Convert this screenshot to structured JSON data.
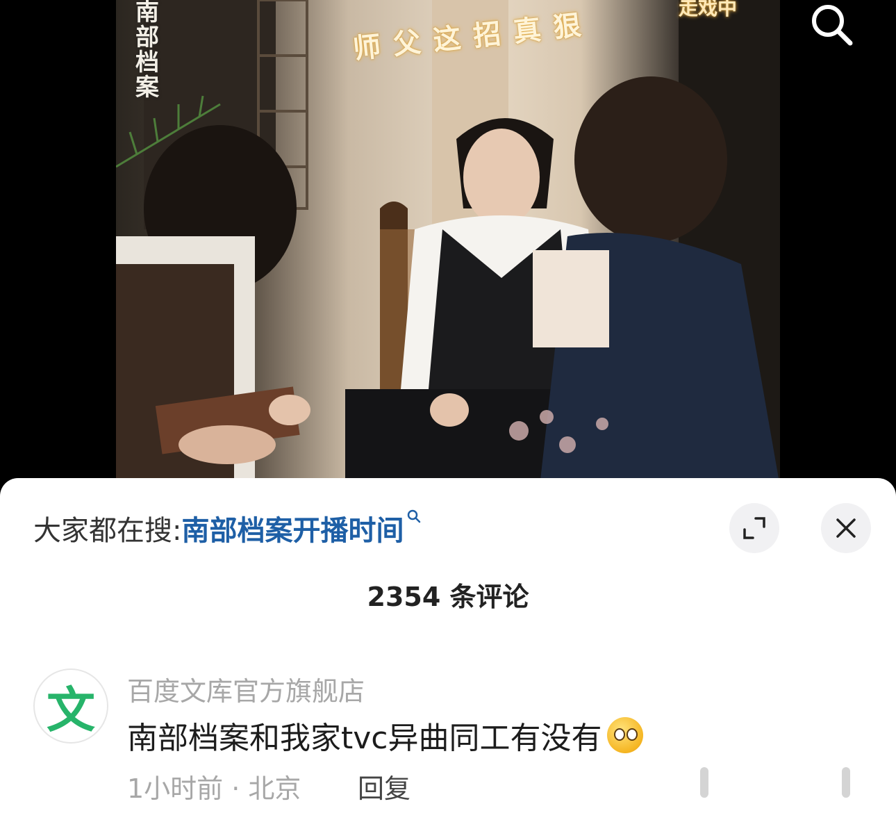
{
  "video": {
    "drama_logo": "南部档案",
    "caption": "师父这招真狠",
    "status_tag": "走戏中"
  },
  "search_icon": "search-icon",
  "trending": {
    "label": "大家都在搜:",
    "query": "南部档案开播时间",
    "query_icon": "search-icon"
  },
  "actions": {
    "expand_icon": "expand-icon",
    "close_icon": "close-icon"
  },
  "comments": {
    "count_text": "2354 条评论",
    "items": [
      {
        "avatar_glyph": "文",
        "author": "百度文库官方旗舰店",
        "text": "南部档案和我家tvc异曲同工有没有",
        "emoji": "pleading-face-emoji",
        "meta": "1小时前 · 北京",
        "reply_label": "回复"
      }
    ]
  },
  "colors": {
    "link": "#1e5fa6",
    "muted": "#a7a7a7",
    "avatar_green": "#27b46a"
  }
}
